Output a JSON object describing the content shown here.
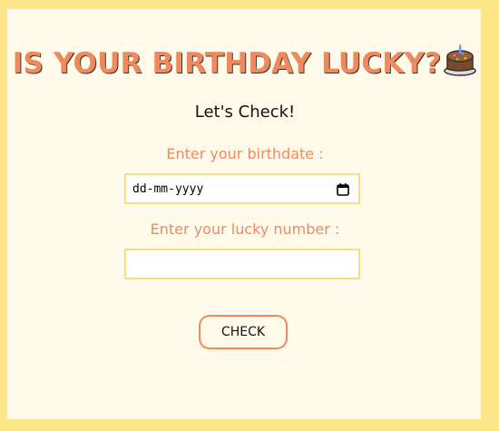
{
  "header": {
    "title": "IS YOUR BIRTHDAY LUCKY?",
    "subtitle": "Let's Check!"
  },
  "form": {
    "birthdate_label": "Enter your birthdate :",
    "birthdate_placeholder": "dd-mm-yyyy",
    "lucky_label": "Enter your lucky number :",
    "lucky_value": "",
    "check_label": "CHECK"
  },
  "colors": {
    "page_bg": "#fde68a",
    "card_bg": "#fffae9",
    "accent": "#f0895c",
    "field_border": "#f8dd87"
  },
  "icons": [
    "cake-icon",
    "calendar-icon"
  ]
}
